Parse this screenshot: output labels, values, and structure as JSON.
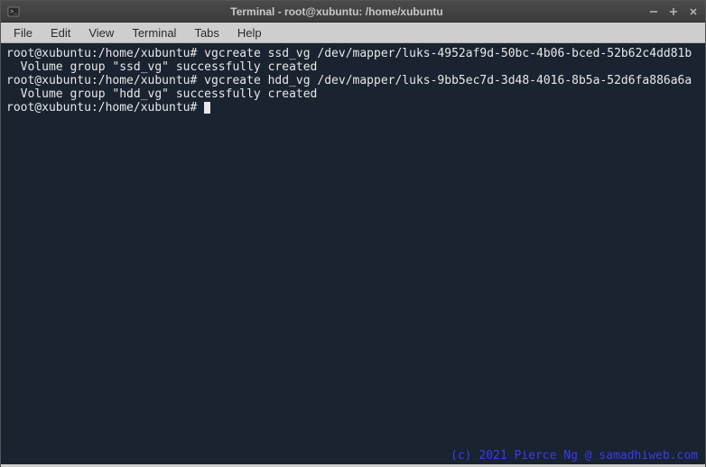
{
  "window": {
    "title": "Terminal - root@xubuntu: /home/xubuntu"
  },
  "menubar": {
    "items": [
      "File",
      "Edit",
      "View",
      "Terminal",
      "Tabs",
      "Help"
    ]
  },
  "terminal": {
    "lines": [
      {
        "prompt": "root@xubuntu:/home/xubuntu# ",
        "command": "vgcreate ssd_vg /dev/mapper/luks-4952af9d-50bc-4b06-bced-52b62c4dd81b"
      },
      {
        "output": "  Volume group \"ssd_vg\" successfully created"
      },
      {
        "prompt": "root@xubuntu:/home/xubuntu# ",
        "command": "vgcreate hdd_vg /dev/mapper/luks-9bb5ec7d-3d48-4016-8b5a-52d6fa886a6a"
      },
      {
        "output": "  Volume group \"hdd_vg\" successfully created"
      },
      {
        "prompt": "root@xubuntu:/home/xubuntu# ",
        "command": "",
        "cursor": true
      }
    ]
  },
  "watermark": "(c) 2021 Pierce Ng @ samadhiweb.com"
}
